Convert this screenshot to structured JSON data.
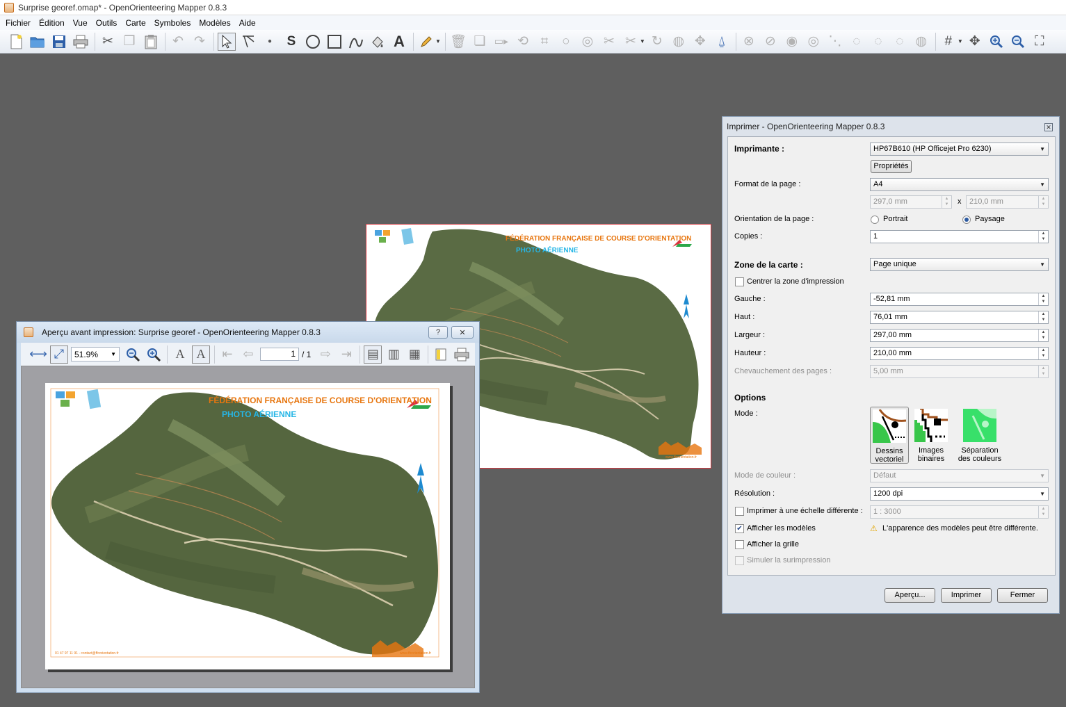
{
  "main_window": {
    "title": "Surprise georef.omap* - OpenOrienteering Mapper 0.8.3",
    "menu": [
      "Fichier",
      "Édition",
      "Vue",
      "Outils",
      "Carte",
      "Symboles",
      "Modèles",
      "Aide"
    ]
  },
  "toolbar_icons": {
    "file": [
      "new-file-icon",
      "open-file-icon",
      "save-icon",
      "print-icon"
    ],
    "edit": [
      "cut-icon",
      "copy-icon",
      "paste-icon",
      "undo-icon",
      "redo-icon"
    ],
    "draw": [
      "edit-objects-icon",
      "edit-lines-icon",
      "draw-point-icon",
      "draw-path-icon",
      "draw-circle-icon",
      "draw-rectangle-icon",
      "draw-freehand-icon",
      "fill-icon",
      "draw-text-icon",
      "pencil-icon"
    ],
    "tools": [
      "delete-icon",
      "duplicate-icon",
      "switch-symbol-icon",
      "rotate-pattern-icon",
      "cut-hole-icon",
      "circle-icon",
      "union-icon",
      "cut-icon",
      "scissors-icon",
      "rotate-icon",
      "scale-icon",
      "move-icon",
      "measure-icon"
    ],
    "view": [
      "grid-icon",
      "pan-icon",
      "zoom-in-icon",
      "zoom-out-icon",
      "fullscreen-icon"
    ]
  },
  "map_sheet": {
    "header": "FÉDÉRATION FRANÇAISE DE COURSE D'ORIENTATION",
    "subheader": "PHOTO AÉRIENNE",
    "footer_left": "01 47 97 11 91 - contact@ffcorientation.fr",
    "footer_right": "www.ffcorientation.fr"
  },
  "preview": {
    "title": "Aperçu avant impression: Surprise georef - OpenOrienteering Mapper 0.8.3",
    "help": "?",
    "close": "✕",
    "zoom": "51.9%",
    "page_current": "1",
    "page_total": "/ 1"
  },
  "print_dialog": {
    "title": "Imprimer - OpenOrienteering Mapper 0.8.3",
    "printer_label": "Imprimante :",
    "printer_value": "HP67B610 (HP Officejet Pro 6230)",
    "properties_button": "Propriétés",
    "page_format_label": "Format de la page :",
    "page_format_value": "A4",
    "page_width": "297,0 mm",
    "page_x": "x",
    "page_height": "210,0 mm",
    "orientation_label": "Orientation de la page :",
    "orientation_portrait": "Portrait",
    "orientation_landscape": "Paysage",
    "copies_label": "Copies :",
    "copies_value": "1",
    "map_area_label": "Zone de la carte :",
    "map_area_value": "Page unique",
    "center_label": "Centrer la zone d'impression",
    "left_label": "Gauche :",
    "left_value": "-52,81 mm",
    "top_label": "Haut :",
    "top_value": "76,01 mm",
    "width_label": "Largeur :",
    "width_value": "297,00 mm",
    "height_label": "Hauteur :",
    "height_value": "210,00 mm",
    "overlap_label": "Chevauchement des pages :",
    "overlap_value": "5,00 mm",
    "options_label": "Options",
    "mode_label": "Mode :",
    "modes": [
      {
        "line1": "Dessins",
        "line2": "vectoriel"
      },
      {
        "line1": "Images",
        "line2": "binaires"
      },
      {
        "line1": "Séparation",
        "line2": "des couleurs"
      }
    ],
    "color_mode_label": "Mode de couleur :",
    "color_mode_value": "Défaut",
    "resolution_label": "Résolution :",
    "resolution_value": "1200 dpi",
    "scale_label": "Imprimer à une échelle différente :",
    "scale_value": "1 : 3000",
    "templates_label": "Afficher les modèles",
    "templates_warning": "L'apparence des modèles peut être différente.",
    "grid_label": "Afficher la grille",
    "overprint_label": "Simuler la surimpression",
    "preview_button": "Aperçu...",
    "print_button": "Imprimer",
    "close_button": "Fermer"
  }
}
